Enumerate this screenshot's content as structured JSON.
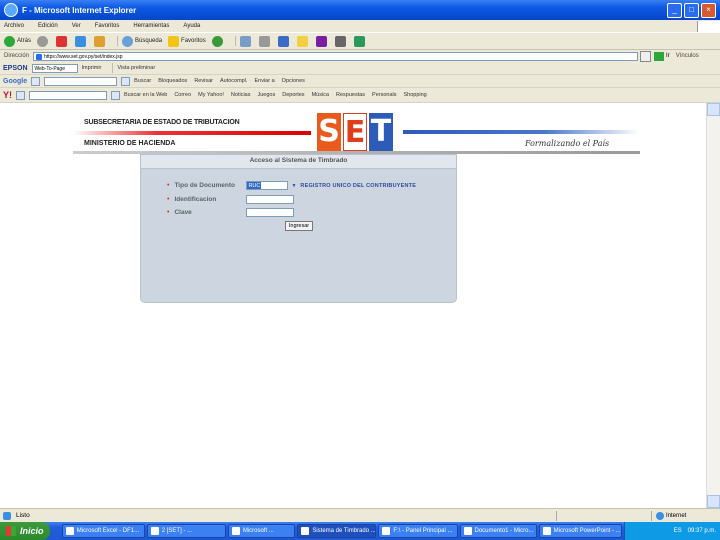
{
  "window": {
    "title": "F - Microsoft Internet Explorer",
    "controls": [
      "_",
      "□",
      "×"
    ]
  },
  "menubar": {
    "items": [
      "Archivo",
      "Edición",
      "Ver",
      "Favoritos",
      "Herramientas",
      "Ayuda"
    ]
  },
  "toolbar": {
    "back_label": "Atrás",
    "search_label": "Búsqueda",
    "favorites_label": "Favoritos"
  },
  "address": {
    "label": "Dirección",
    "url": "https://www.set.gov.py/set/index.jsp",
    "go_label": "Ir",
    "links_label": "Vínculos"
  },
  "epson_bar": {
    "brand": "EPSON",
    "dropdown_value": "Web-To-Page",
    "print_label": "Imprimir",
    "preview_label": "Vista preliminar"
  },
  "google_bar": {
    "brand": "Google",
    "search_label": "Buscar",
    "items": [
      "Bloqueados",
      "Revisar",
      "Autocompl.",
      "Enviar a",
      "Opciones"
    ]
  },
  "yahoo_bar": {
    "brand": "Y!",
    "search_label": "Buscar en la Web",
    "items": [
      "Correo",
      "My Yahoo!",
      "Noticias",
      "Juegos",
      "Deportes",
      "Música",
      "Respuestas",
      "Personals",
      "Shopping"
    ]
  },
  "header": {
    "subsecretaria": "SUBSECRETARIA DE ESTADO DE TRIBUTACION",
    "ministerio": "MINISTERIO DE HACIENDA",
    "logo_letters": [
      "S",
      "E",
      "T"
    ],
    "slogan": "Formalizando el País"
  },
  "login": {
    "title": "Acceso al Sistema de Timbrado",
    "doc_type_label": "Tipo de Documento",
    "doc_type_value": "RUC",
    "registro_link": "REGISTRO UNICO DEL CONTRIBUYENTE",
    "identificacion_label": "Identificacion",
    "clave_label": "Clave",
    "submit_label": "Ingresar"
  },
  "statusbar": {
    "text": "Listo",
    "zone": "Internet"
  },
  "taskbar": {
    "start_label": "Inicio",
    "tasks": [
      "Microsoft Excel - DF1...",
      "2 [SET] - ...",
      "Microsoft ...",
      "Sistema de Timbrado ...",
      "F:\\ - Panel Principal ...",
      "Documento1 - Micro...",
      "Microsoft PowerPoint - ..."
    ],
    "clock": "09:37 p.m.",
    "language": "ES"
  },
  "colors": {
    "titlebar": "#0a58e4",
    "set_orange": "#e85b1c",
    "set_blue": "#2d5bb8",
    "panel": "#ccd5e0",
    "taskbar": "#245edb"
  }
}
